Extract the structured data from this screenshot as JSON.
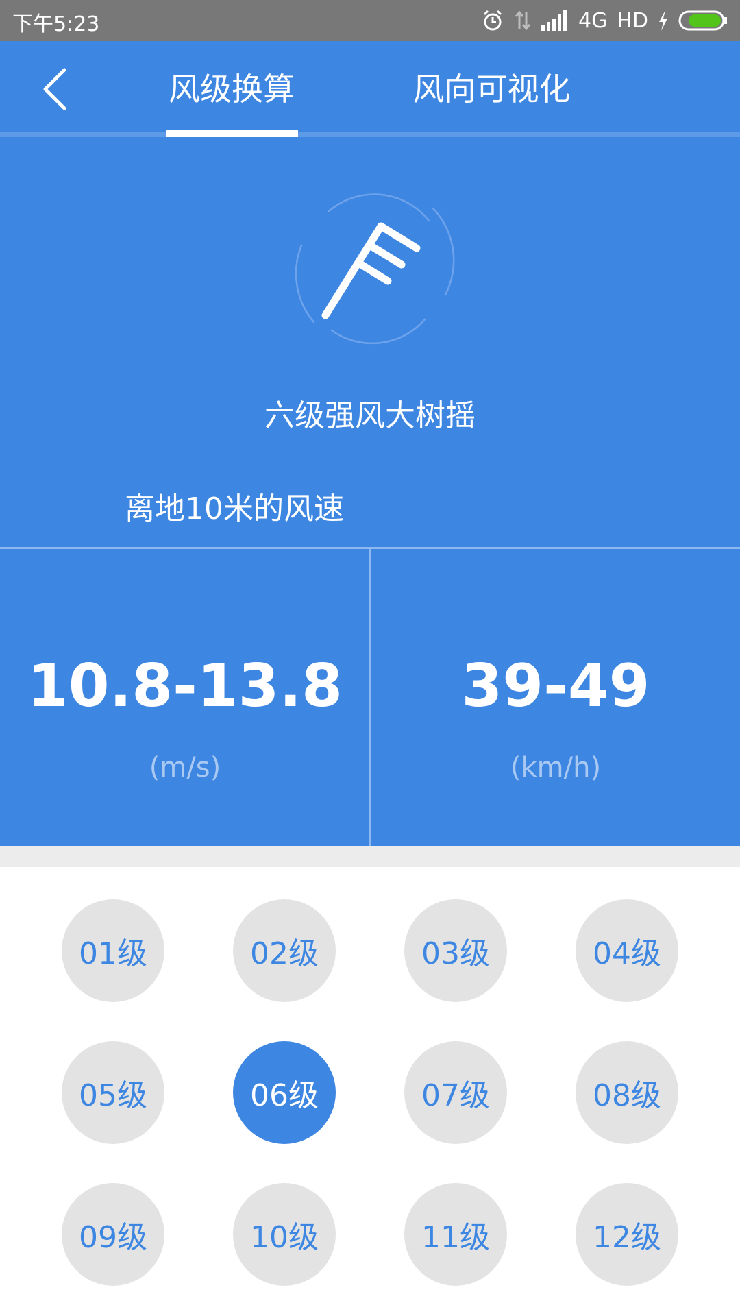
{
  "status_bar": {
    "time": "下午5:23",
    "network": "4G",
    "hd": "HD"
  },
  "header": {
    "tabs": [
      {
        "label": "风级换算",
        "active": true
      },
      {
        "label": "风向可视化",
        "active": false
      }
    ]
  },
  "hero": {
    "level_title": "六级强风大树摇",
    "speed_caption": "离地10米的风速"
  },
  "speeds": {
    "ms": {
      "value": "10.8-13.8",
      "unit": "(m/s)"
    },
    "kmh": {
      "value": "39-49",
      "unit": "(km/h)"
    }
  },
  "levels": {
    "items": [
      "01级",
      "02级",
      "03级",
      "04级",
      "05级",
      "06级",
      "07级",
      "08级",
      "09级",
      "10级",
      "11级",
      "12级"
    ],
    "selected_index": 5
  },
  "colors": {
    "accent": "#3d86e2",
    "chip_bg": "#e3e3e3",
    "battery": "#52c41a"
  }
}
